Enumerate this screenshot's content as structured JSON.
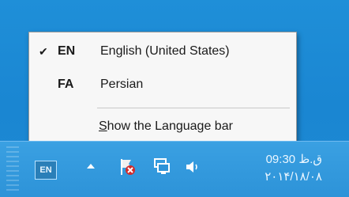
{
  "menu": {
    "items": [
      {
        "check": "✔",
        "code": "EN",
        "name": "English (United States)"
      },
      {
        "check": "",
        "code": "FA",
        "name": "Persian"
      }
    ],
    "show_bar_prefix": "S",
    "show_bar_rest": "how the Language bar"
  },
  "taskbar": {
    "language_indicator": "EN",
    "icons": [
      "chevron-up-icon",
      "action-center-flag-icon",
      "network-icon",
      "speaker-icon"
    ],
    "time": "09:30 ق.ظ",
    "date": "۲۰۱۴/۱۸/۰۸"
  },
  "colors": {
    "desktop": "#1f8fd8",
    "taskbar": "#2d93d8",
    "menu_bg": "#f7f7f7",
    "alert_red": "#d22b2b"
  }
}
